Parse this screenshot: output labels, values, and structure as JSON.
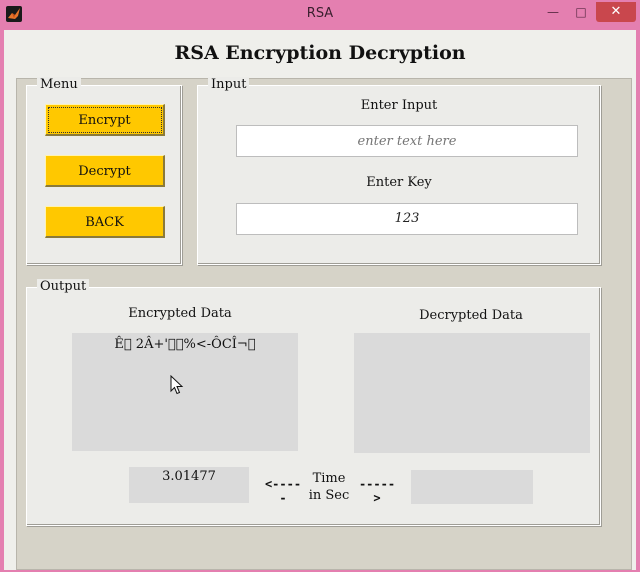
{
  "window": {
    "title": "RSA",
    "minimize": "—",
    "maximize": "□",
    "close": "✕"
  },
  "header": {
    "title": "RSA Encryption Decryption"
  },
  "menu": {
    "label": "Menu",
    "encrypt": "Encrypt",
    "decrypt": "Decrypt",
    "back": "BACK"
  },
  "input": {
    "label": "Input",
    "enter_input_label": "Enter Input",
    "input_placeholder": "enter text here",
    "input_value": "",
    "enter_key_label": "Enter Key",
    "key_value": "123"
  },
  "output": {
    "label": "Output",
    "encrypted_label": "Encrypted Data",
    "encrypted_value": "Ê\u0000 2Â+'\u0000\u0000%<-ÔCÎ¬\u0000",
    "decrypted_label": "Decrypted Data",
    "decrypted_value": "",
    "time_value": "3.01477",
    "arrow_left": "<-----",
    "time_label": "Time in Sec",
    "arrow_right": "----->",
    "time_value_2": ""
  },
  "colors": {
    "button": "#ffc800",
    "background": "#e47fb0",
    "panel": "#ecece9"
  }
}
